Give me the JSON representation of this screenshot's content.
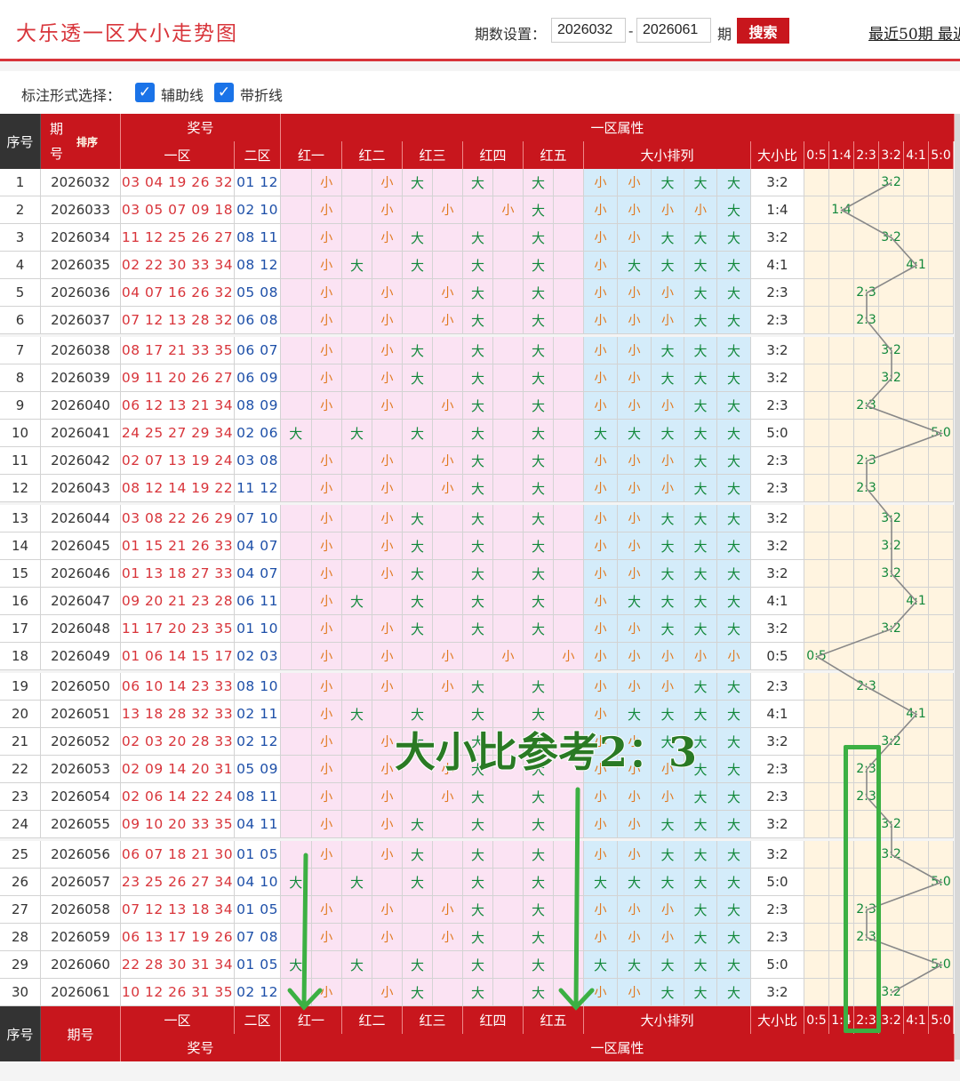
{
  "header": {
    "title": "大乐透一区大小走势图",
    "period_label": "期数设置：",
    "from": "2026032",
    "dash": "-",
    "to": "2026061",
    "period_suffix": "期",
    "search_label": "搜索",
    "recent_label": "最近50期 最近"
  },
  "options": {
    "label": "标注形式选择：",
    "aux_label": "辅助线",
    "line_label": "带折线"
  },
  "table": {
    "head": {
      "seq": "序号",
      "issue": "期号",
      "sort": "排序",
      "award": "奖号",
      "area1": "一区",
      "area2": "二区",
      "attr": "一区属性",
      "reds": [
        "红一",
        "红二",
        "红三",
        "红四",
        "红五"
      ],
      "arr": "大小排列",
      "ratio": "大小比",
      "ratios": [
        "0:5",
        "1:4",
        "2:3",
        "3:2",
        "4:1",
        "5:0"
      ]
    },
    "rows": [
      {
        "seq": "1",
        "issue": "2026032",
        "front": "03 04 19 26 32",
        "back": "01 12",
        "bs": [
          "小",
          "小",
          "大",
          "大",
          "大"
        ],
        "ratio": "3:2"
      },
      {
        "seq": "2",
        "issue": "2026033",
        "front": "03 05 07 09 18",
        "back": "02 10",
        "bs": [
          "小",
          "小",
          "小",
          "小",
          "大"
        ],
        "ratio": "1:4"
      },
      {
        "seq": "3",
        "issue": "2026034",
        "front": "11 12 25 26 27",
        "back": "08 11",
        "bs": [
          "小",
          "小",
          "大",
          "大",
          "大"
        ],
        "ratio": "3:2"
      },
      {
        "seq": "4",
        "issue": "2026035",
        "front": "02 22 30 33 34",
        "back": "08 12",
        "bs": [
          "小",
          "大",
          "大",
          "大",
          "大"
        ],
        "ratio": "4:1"
      },
      {
        "seq": "5",
        "issue": "2026036",
        "front": "04 07 16 26 32",
        "back": "05 08",
        "bs": [
          "小",
          "小",
          "小",
          "大",
          "大"
        ],
        "ratio": "2:3"
      },
      {
        "seq": "6",
        "issue": "2026037",
        "front": "07 12 13 28 32",
        "back": "06 08",
        "bs": [
          "小",
          "小",
          "小",
          "大",
          "大"
        ],
        "ratio": "2:3"
      },
      {
        "seq": "7",
        "issue": "2026038",
        "front": "08 17 21 33 35",
        "back": "06 07",
        "bs": [
          "小",
          "小",
          "大",
          "大",
          "大"
        ],
        "ratio": "3:2"
      },
      {
        "seq": "8",
        "issue": "2026039",
        "front": "09 11 20 26 27",
        "back": "06 09",
        "bs": [
          "小",
          "小",
          "大",
          "大",
          "大"
        ],
        "ratio": "3:2"
      },
      {
        "seq": "9",
        "issue": "2026040",
        "front": "06 12 13 21 34",
        "back": "08 09",
        "bs": [
          "小",
          "小",
          "小",
          "大",
          "大"
        ],
        "ratio": "2:3"
      },
      {
        "seq": "10",
        "issue": "2026041",
        "front": "24 25 27 29 34",
        "back": "02 06",
        "bs": [
          "大",
          "大",
          "大",
          "大",
          "大"
        ],
        "ratio": "5:0"
      },
      {
        "seq": "11",
        "issue": "2026042",
        "front": "02 07 13 19 24",
        "back": "03 08",
        "bs": [
          "小",
          "小",
          "小",
          "大",
          "大"
        ],
        "ratio": "2:3"
      },
      {
        "seq": "12",
        "issue": "2026043",
        "front": "08 12 14 19 22",
        "back": "11 12",
        "bs": [
          "小",
          "小",
          "小",
          "大",
          "大"
        ],
        "ratio": "2:3"
      },
      {
        "seq": "13",
        "issue": "2026044",
        "front": "03 08 22 26 29",
        "back": "07 10",
        "bs": [
          "小",
          "小",
          "大",
          "大",
          "大"
        ],
        "ratio": "3:2"
      },
      {
        "seq": "14",
        "issue": "2026045",
        "front": "01 15 21 26 33",
        "back": "04 07",
        "bs": [
          "小",
          "小",
          "大",
          "大",
          "大"
        ],
        "ratio": "3:2"
      },
      {
        "seq": "15",
        "issue": "2026046",
        "front": "01 13 18 27 33",
        "back": "04 07",
        "bs": [
          "小",
          "小",
          "大",
          "大",
          "大"
        ],
        "ratio": "3:2"
      },
      {
        "seq": "16",
        "issue": "2026047",
        "front": "09 20 21 23 28",
        "back": "06 11",
        "bs": [
          "小",
          "大",
          "大",
          "大",
          "大"
        ],
        "ratio": "4:1"
      },
      {
        "seq": "17",
        "issue": "2026048",
        "front": "11 17 20 23 35",
        "back": "01 10",
        "bs": [
          "小",
          "小",
          "大",
          "大",
          "大"
        ],
        "ratio": "3:2"
      },
      {
        "seq": "18",
        "issue": "2026049",
        "front": "01 06 14 15 17",
        "back": "02 03",
        "bs": [
          "小",
          "小",
          "小",
          "小",
          "小"
        ],
        "ratio": "0:5"
      },
      {
        "seq": "19",
        "issue": "2026050",
        "front": "06 10 14 23 33",
        "back": "08 10",
        "bs": [
          "小",
          "小",
          "小",
          "大",
          "大"
        ],
        "ratio": "2:3"
      },
      {
        "seq": "20",
        "issue": "2026051",
        "front": "13 18 28 32 33",
        "back": "02 11",
        "bs": [
          "小",
          "大",
          "大",
          "大",
          "大"
        ],
        "ratio": "4:1"
      },
      {
        "seq": "21",
        "issue": "2026052",
        "front": "02 03 20 28 33",
        "back": "02 12",
        "bs": [
          "小",
          "小",
          "大",
          "大",
          "大"
        ],
        "ratio": "3:2"
      },
      {
        "seq": "22",
        "issue": "2026053",
        "front": "02 09 14 20 31",
        "back": "05 09",
        "bs": [
          "小",
          "小",
          "小",
          "大",
          "大"
        ],
        "ratio": "2:3"
      },
      {
        "seq": "23",
        "issue": "2026054",
        "front": "02 06 14 22 24",
        "back": "08 11",
        "bs": [
          "小",
          "小",
          "小",
          "大",
          "大"
        ],
        "ratio": "2:3"
      },
      {
        "seq": "24",
        "issue": "2026055",
        "front": "09 10 20 33 35",
        "back": "04 11",
        "bs": [
          "小",
          "小",
          "大",
          "大",
          "大"
        ],
        "ratio": "3:2"
      },
      {
        "seq": "25",
        "issue": "2026056",
        "front": "06 07 18 21 30",
        "back": "01 05",
        "bs": [
          "小",
          "小",
          "大",
          "大",
          "大"
        ],
        "ratio": "3:2"
      },
      {
        "seq": "26",
        "issue": "2026057",
        "front": "23 25 26 27 34",
        "back": "04 10",
        "bs": [
          "大",
          "大",
          "大",
          "大",
          "大"
        ],
        "ratio": "5:0"
      },
      {
        "seq": "27",
        "issue": "2026058",
        "front": "07 12 13 18 34",
        "back": "01 05",
        "bs": [
          "小",
          "小",
          "小",
          "大",
          "大"
        ],
        "ratio": "2:3"
      },
      {
        "seq": "28",
        "issue": "2026059",
        "front": "06 13 17 19 26",
        "back": "07 08",
        "bs": [
          "小",
          "小",
          "小",
          "大",
          "大"
        ],
        "ratio": "2:3"
      },
      {
        "seq": "29",
        "issue": "2026060",
        "front": "22 28 30 31 34",
        "back": "01 05",
        "bs": [
          "大",
          "大",
          "大",
          "大",
          "大"
        ],
        "ratio": "5:0"
      },
      {
        "seq": "30",
        "issue": "2026061",
        "front": "10 12 26 31 35",
        "back": "02 12",
        "bs": [
          "小",
          "小",
          "大",
          "大",
          "大"
        ],
        "ratio": "3:2"
      }
    ]
  },
  "annotation": {
    "text": "大小比参考2：3"
  },
  "colors": {
    "brand_red": "#c8161d",
    "big_green": "#12883b",
    "small_orange": "#e0781e",
    "pink_bg": "#fbe3f3",
    "blue_bg": "#d4ecfa",
    "orange_bg": "#fff4e0",
    "annotation_green": "#3cb043"
  }
}
